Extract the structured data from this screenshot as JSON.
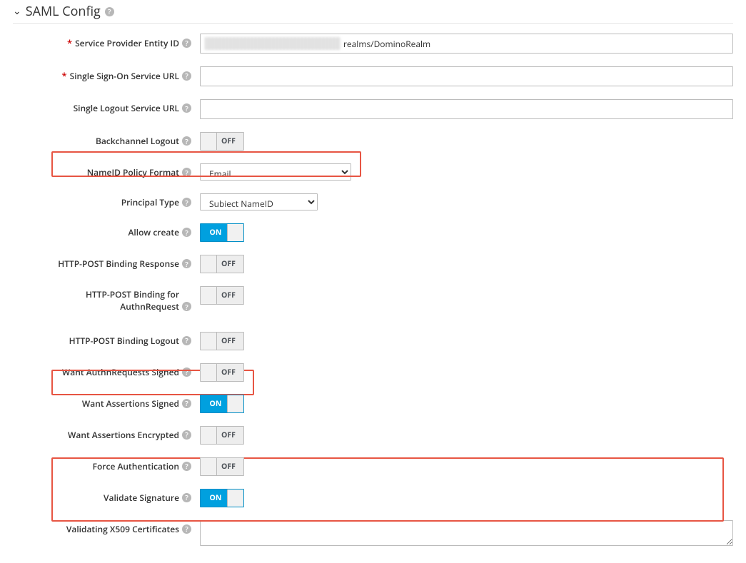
{
  "section": {
    "title": "SAML Config"
  },
  "labels": {
    "entityId": "Service Provider Entity ID",
    "ssoUrl": "Single Sign-On Service URL",
    "sloUrl": "Single Logout Service URL",
    "backchannel": "Backchannel Logout",
    "nameIdPolicy": "NameID Policy Format",
    "principalType": "Principal Type",
    "allowCreate": "Allow create",
    "httpPostResp": "HTTP-POST Binding Response",
    "httpPostAuthn": "HTTP-POST Binding for AuthnRequest",
    "httpPostLogout": "HTTP-POST Binding Logout",
    "wantAuthnSigned": "Want AuthnRequests Signed",
    "wantAssertSigned": "Want Assertions Signed",
    "wantAssertEnc": "Want Assertions Encrypted",
    "forceAuthn": "Force Authentication",
    "validateSig": "Validate Signature",
    "x509": "Validating X509 Certificates"
  },
  "values": {
    "entityId": "realms/DominoRealm",
    "ssoUrl": "",
    "sloUrl": "",
    "nameIdPolicy": "Email",
    "principalType": "Subject NameID",
    "x509": ""
  },
  "toggles": {
    "on": "ON",
    "off": "OFF",
    "backchannel": false,
    "allowCreate": true,
    "httpPostResp": false,
    "httpPostAuthn": false,
    "httpPostLogout": false,
    "wantAuthnSigned": false,
    "wantAssertSigned": true,
    "wantAssertEnc": false,
    "forceAuthn": false,
    "validateSig": true
  }
}
